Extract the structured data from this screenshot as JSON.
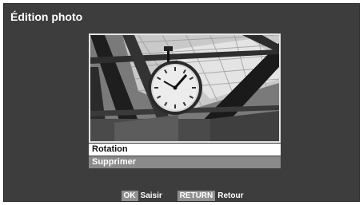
{
  "screen": {
    "title": "Édition photo"
  },
  "photo": {
    "subject_icon": "station-clock-photo"
  },
  "menu": {
    "items": [
      {
        "label": "Rotation",
        "selected": true
      },
      {
        "label": "Supprimer",
        "selected": false
      }
    ]
  },
  "footer": {
    "hints": [
      {
        "key": "OK",
        "label": "Saisir"
      },
      {
        "key": "RETURN",
        "label": "Retour"
      }
    ]
  },
  "colors": {
    "background": "#3d3d3d",
    "selected_item": "#ffffff",
    "menu_item": "#8a8a8a",
    "key_badge": "#8f8f8f"
  }
}
